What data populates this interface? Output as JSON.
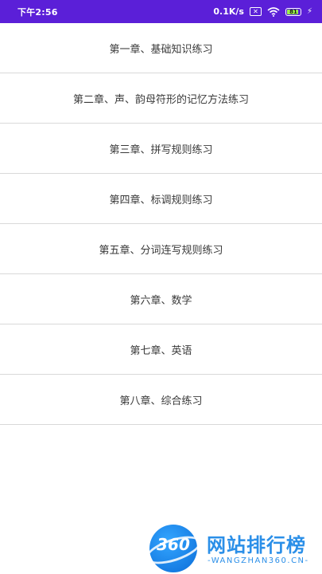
{
  "status_bar": {
    "time": "下午2:56",
    "network_speed": "0.1K/s",
    "sim_icon_text": "✕",
    "battery_level": "81",
    "wifi_icon": "wifi-icon",
    "charging_icon": "lightning-icon"
  },
  "chapters": [
    "第一章、基础知识练习",
    "第二章、声、韵母符形的记忆方法练习",
    "第三章、拼写规则练习",
    "第四章、标调规则练习",
    "第五章、分词连写规则练习",
    "第六章、数学",
    "第七章、英语",
    "第八章、综合练习"
  ],
  "watermark": {
    "logo_number": "360",
    "site_name": "网站排行榜",
    "url": "-WANGZHAN360.CN-"
  },
  "colors": {
    "status_bar_bg": "#5b1fd8",
    "divider": "#d9d9d9",
    "text": "#3a3a3a",
    "watermark_blue": "#2b8fe8"
  }
}
